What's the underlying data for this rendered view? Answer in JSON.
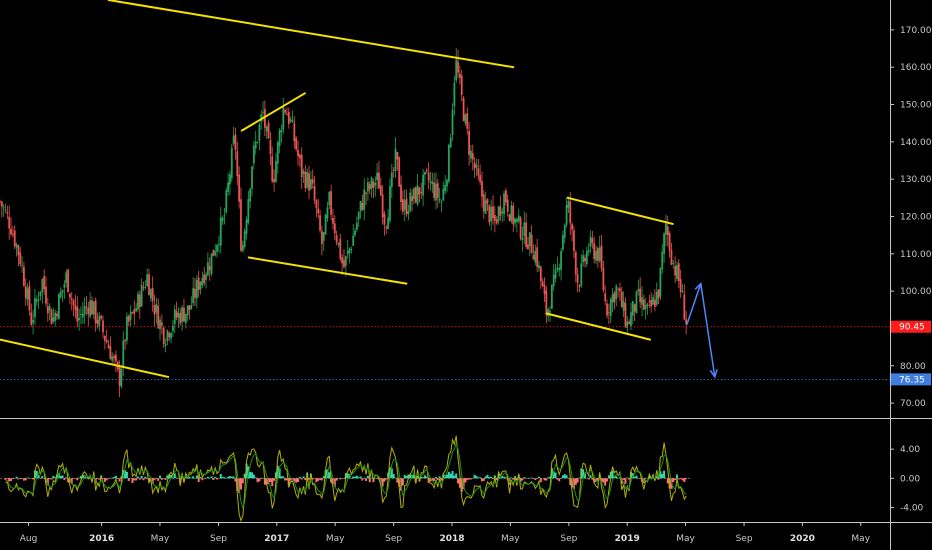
{
  "chart_data": [
    {
      "type": "candlestick",
      "panel": "price",
      "yticks": [
        "170.00",
        "160.00",
        "150.00",
        "140.00",
        "130.00",
        "120.00",
        "110.00",
        "100.00",
        "90.00",
        "80.00",
        "70.00"
      ],
      "ytick_values": [
        170,
        160,
        150,
        140,
        130,
        120,
        110,
        100,
        90,
        80,
        70
      ],
      "ylim": [
        66,
        178
      ],
      "x_labels": [
        {
          "label": "Aug",
          "t": 2015.583,
          "year": false
        },
        {
          "label": "2016",
          "t": 2016.0,
          "year": true
        },
        {
          "label": "May",
          "t": 2016.333,
          "year": false
        },
        {
          "label": "Sep",
          "t": 2016.667,
          "year": false
        },
        {
          "label": "2017",
          "t": 2017.0,
          "year": true
        },
        {
          "label": "May",
          "t": 2017.333,
          "year": false
        },
        {
          "label": "Sep",
          "t": 2017.667,
          "year": false
        },
        {
          "label": "2018",
          "t": 2018.0,
          "year": true
        },
        {
          "label": "May",
          "t": 2018.333,
          "year": false
        },
        {
          "label": "Sep",
          "t": 2018.667,
          "year": false
        },
        {
          "label": "2019",
          "t": 2019.0,
          "year": true
        },
        {
          "label": "May",
          "t": 2019.333,
          "year": false
        },
        {
          "label": "Sep",
          "t": 2019.667,
          "year": false
        },
        {
          "label": "2020",
          "t": 2020.0,
          "year": true
        },
        {
          "label": "May",
          "t": 2020.333,
          "year": false
        }
      ],
      "xlim": [
        2015.42,
        2020.5
      ],
      "price_path": [
        [
          2015.42,
          124
        ],
        [
          2015.48,
          118
        ],
        [
          2015.54,
          108
        ],
        [
          2015.6,
          92
        ],
        [
          2015.66,
          103
        ],
        [
          2015.72,
          92
        ],
        [
          2015.8,
          104
        ],
        [
          2015.86,
          92
        ],
        [
          2015.93,
          97
        ],
        [
          2016.0,
          90
        ],
        [
          2016.05,
          84
        ],
        [
          2016.1,
          76
        ],
        [
          2016.14,
          90
        ],
        [
          2016.2,
          96
        ],
        [
          2016.26,
          104
        ],
        [
          2016.3,
          96
        ],
        [
          2016.36,
          88
        ],
        [
          2016.42,
          93
        ],
        [
          2016.5,
          95
        ],
        [
          2016.56,
          103
        ],
        [
          2016.62,
          108
        ],
        [
          2016.7,
          120
        ],
        [
          2016.76,
          142
        ],
        [
          2016.8,
          110
        ],
        [
          2016.86,
          135
        ],
        [
          2016.92,
          148
        ],
        [
          2016.98,
          130
        ],
        [
          2017.04,
          150
        ],
        [
          2017.08,
          145
        ],
        [
          2017.14,
          132
        ],
        [
          2017.2,
          128
        ],
        [
          2017.26,
          112
        ],
        [
          2017.3,
          124
        ],
        [
          2017.38,
          106
        ],
        [
          2017.42,
          112
        ],
        [
          2017.5,
          126
        ],
        [
          2017.58,
          130
        ],
        [
          2017.62,
          118
        ],
        [
          2017.68,
          136
        ],
        [
          2017.72,
          122
        ],
        [
          2017.78,
          125
        ],
        [
          2017.86,
          130
        ],
        [
          2017.94,
          124
        ],
        [
          2017.98,
          135
        ],
        [
          2018.02,
          162
        ],
        [
          2018.06,
          150
        ],
        [
          2018.1,
          138
        ],
        [
          2018.18,
          124
        ],
        [
          2018.24,
          118
        ],
        [
          2018.3,
          126
        ],
        [
          2018.34,
          120
        ],
        [
          2018.42,
          115
        ],
        [
          2018.48,
          110
        ],
        [
          2018.54,
          94
        ],
        [
          2018.6,
          105
        ],
        [
          2018.66,
          124
        ],
        [
          2018.72,
          102
        ],
        [
          2018.78,
          112
        ],
        [
          2018.84,
          110
        ],
        [
          2018.88,
          95
        ],
        [
          2018.94,
          101
        ],
        [
          2019.0,
          91
        ],
        [
          2019.06,
          98
        ],
        [
          2019.12,
          94
        ],
        [
          2019.18,
          100
        ],
        [
          2019.22,
          118
        ],
        [
          2019.26,
          108
        ],
        [
          2019.3,
          102
        ],
        [
          2019.34,
          91
        ]
      ],
      "drawings": [
        {
          "name": "trendline-top",
          "from": [
            2016.04,
            178
          ],
          "to": [
            2018.35,
            160
          ],
          "color": "#f5e200"
        },
        {
          "name": "trendline-channel-1-top",
          "from": [
            2016.8,
            143
          ],
          "to": [
            2017.16,
            153
          ],
          "color": "#f5e200"
        },
        {
          "name": "trendline-channel-1-bottom",
          "from": [
            2016.84,
            109
          ],
          "to": [
            2017.74,
            102
          ],
          "color": "#f5e200"
        },
        {
          "name": "trendline-bottom-left",
          "from": [
            2015.42,
            87
          ],
          "to": [
            2016.38,
            77
          ],
          "color": "#f5e200"
        },
        {
          "name": "trendline-channel-2-top",
          "from": [
            2018.66,
            125
          ],
          "to": [
            2019.26,
            118
          ],
          "color": "#f5e200"
        },
        {
          "name": "trendline-channel-2-bottom",
          "from": [
            2018.54,
            94
          ],
          "to": [
            2019.13,
            87
          ],
          "color": "#f5e200"
        }
      ],
      "projection": {
        "color": "#4f86ff",
        "points": [
          [
            2019.34,
            91
          ],
          [
            2019.42,
            102
          ],
          [
            2019.5,
            77
          ]
        ]
      },
      "price_lines": [
        {
          "value": 90.45,
          "label": "90.45",
          "color": "#ff1b1b",
          "badge_color": "#ff1b1b"
        },
        {
          "value": 76.35,
          "label": "76.35",
          "color": "#3f7de0",
          "badge_color": "#3f7de0"
        }
      ],
      "candle_colors": {
        "up": "#26a65b",
        "down": "#ef5350"
      }
    },
    {
      "type": "oscillator",
      "panel": "indicator",
      "yticks": [
        "4.00",
        "0.00",
        "-4.00"
      ],
      "ytick_values": [
        4,
        0,
        -4
      ],
      "ylim": [
        -6,
        8
      ],
      "line_colors": [
        "#b5b000",
        "#1f8f1f"
      ],
      "hist_colors": {
        "up": "#33d6b0",
        "down": "#ff7070"
      },
      "end_t": 2019.36
    }
  ]
}
